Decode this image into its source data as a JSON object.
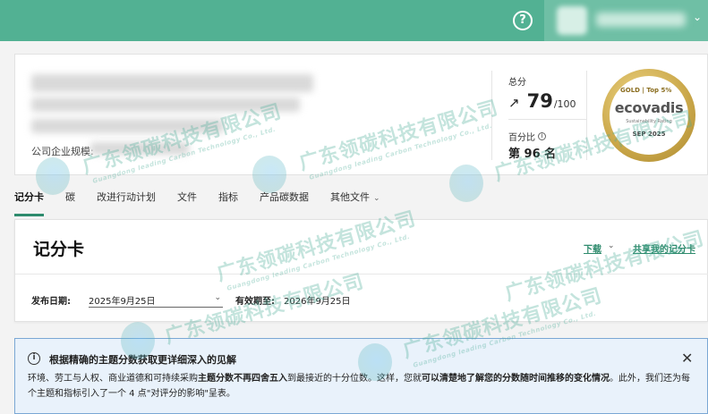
{
  "company": {
    "registration_label": "公司企业规模:"
  },
  "score": {
    "label": "总分",
    "value": "79",
    "total": "/100",
    "percentile_label": "百分比",
    "percentile_value": "第 96 名"
  },
  "medal": {
    "top_text": "GOLD | Top 5%",
    "brand": "ecovadis",
    "subtitle": "Sustainability Rating",
    "date": "SEP 2025"
  },
  "tabs": [
    {
      "label": "记分卡"
    },
    {
      "label": "碳"
    },
    {
      "label": "改进行动计划"
    },
    {
      "label": "文件"
    },
    {
      "label": "指标"
    },
    {
      "label": "产品碳数据"
    },
    {
      "label": "其他文件"
    }
  ],
  "scorecard": {
    "title": "记分卡",
    "download": "下载",
    "share": "共享我的记分卡",
    "publish_label": "发布日期:",
    "publish_value": "2025年9月25日",
    "valid_label": "有效期至:",
    "valid_value": "2026年9月25日"
  },
  "banner": {
    "title": "根据精确的主题分数获取更详细深入的见解",
    "body_1": "环境、劳工与人权、商业道德和可持续采购",
    "body_bold_1": "主题分数不再四舍五入",
    "body_2": "到最接近的十分位数。这样，您就",
    "body_bold_2": "可以清楚地了解您的分数随时间推移的变化情况",
    "body_3": "。此外，我们还为每个主题和指标引入了一个 4 点\"对评分的影响\"呈表。"
  },
  "watermark": {
    "cn": "广东领碳科技有限公司",
    "en": "Guangdong leading Carbon Technology Co., Ltd."
  }
}
